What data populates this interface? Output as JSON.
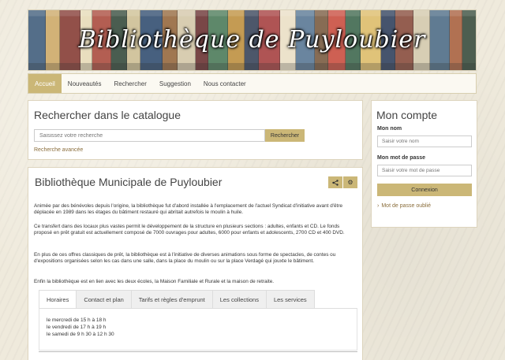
{
  "banner": {
    "title": "Bibliothèque de Puyloubier"
  },
  "nav": {
    "items": [
      {
        "label": "Accueil",
        "active": true
      },
      {
        "label": "Nouveautés",
        "active": false
      },
      {
        "label": "Rechercher",
        "active": false
      },
      {
        "label": "Suggestion",
        "active": false
      },
      {
        "label": "Nous contacter",
        "active": false
      }
    ]
  },
  "search": {
    "title": "Rechercher dans le catalogue",
    "placeholder": "Saisissez votre recherche",
    "button": "Rechercher",
    "advanced": "Recherche avancée"
  },
  "account": {
    "title": "Mon compte",
    "name_label": "Mon nom",
    "name_placeholder": "Saisir votre nom",
    "password_label": "Mon mot de passe",
    "password_placeholder": "Saisir votre mot de passe",
    "login_button": "Connexion",
    "forgot": "Mot de passe oublié"
  },
  "main": {
    "title": "Bibliothèque Municipale de Puyloubier",
    "paragraphs": [
      "Animée par des bénévoles depuis l'origine, la bibliothèque fut d'abord installée à l'emplacement de l'actuel Syndicat d'initiative avant d'être déplacée en 1989 dans les étages du bâtiment restauré qui abritait autrefois le moulin à huile.",
      "Ce transfert dans des locaux plus vastes permit le développement de la structure en plusieurs sections : adultes, enfants et CD. Le fonds proposé en prêt gratuit est actuellement composé de 7000 ouvrages pour adultes, 6000 pour enfants et adolescents, 2700 CD et 400 DVD.",
      "En plus de ces offres classiques de prêt, la bibliothèque est à l'initiative de diverses animations sous forme de spectacles, de contes ou d'expositions organisées selon les cas dans une salle, dans la place du moulin ou sur la place Verdagé qui jouxte le bâtiment.",
      "Enfin la bibliothèque est en lien avec les deux écoles, la Maison Familiale et Rurale et la maison de retraite."
    ],
    "tabs": [
      {
        "label": "Horaires",
        "active": true
      },
      {
        "label": "Contact et plan",
        "active": false
      },
      {
        "label": "Tarifs et règles d'emprunt",
        "active": false
      },
      {
        "label": "Les collections",
        "active": false
      },
      {
        "label": "Les services",
        "active": false
      }
    ],
    "hours": [
      "le mercredi de 15 h à 18 h",
      "le vendredi de 17 h à 19 h",
      "le samedi de 9 h 30 à 12 h 30"
    ]
  },
  "icons": {
    "share": "share-icon",
    "settings": "gear-icon",
    "forgot": "chevron-right-icon"
  },
  "colors": {
    "accent": "#cbb777",
    "link": "#8a6d3b"
  }
}
